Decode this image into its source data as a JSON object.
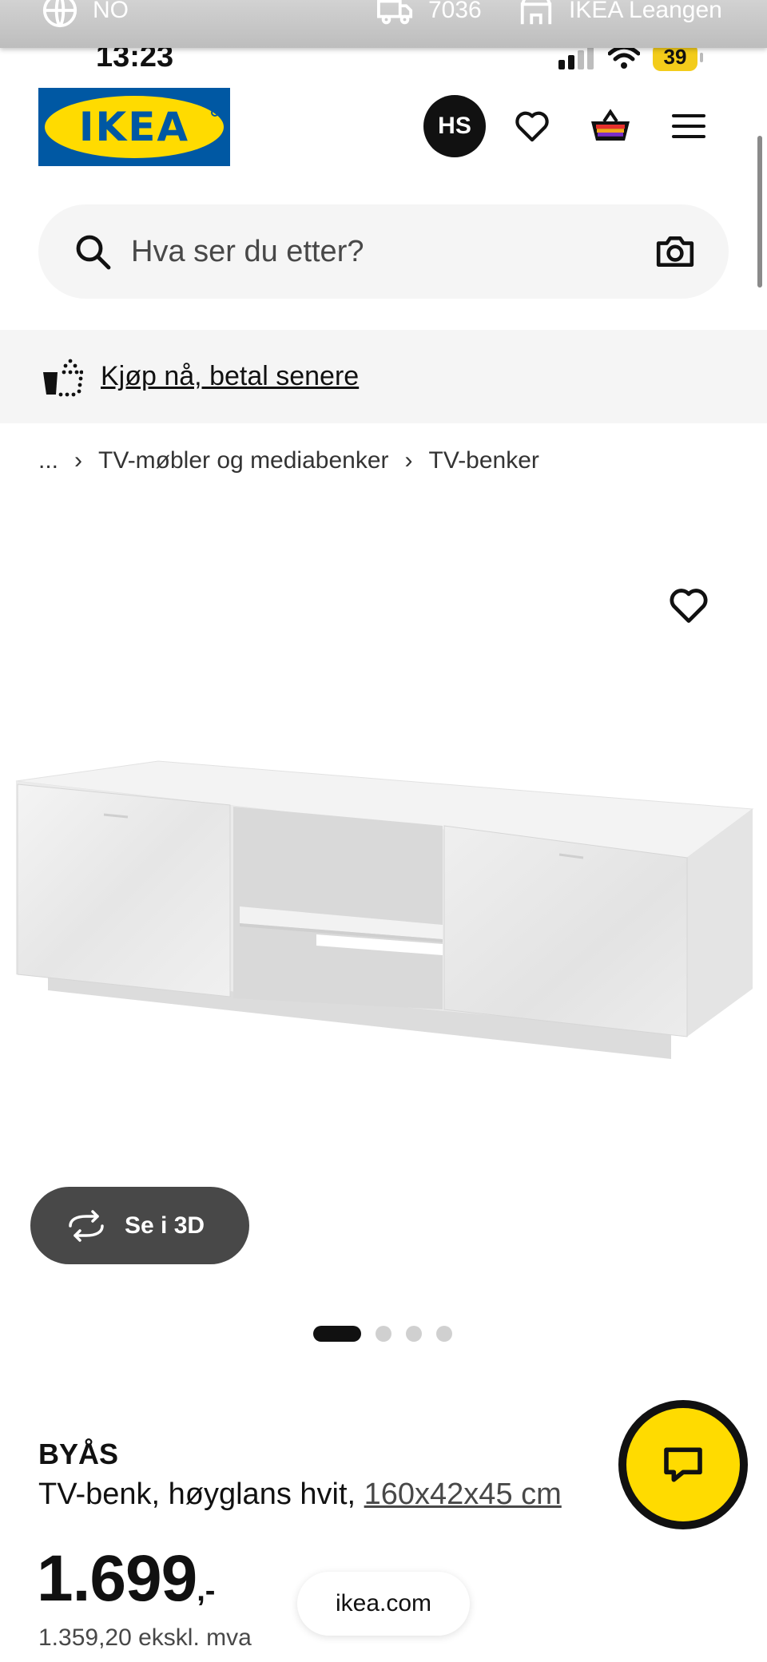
{
  "topbar": {
    "country": "NO",
    "postcode": "7036",
    "store": "IKEA Leangen"
  },
  "status": {
    "time": "13:23",
    "battery": "39"
  },
  "header": {
    "logo_text": "IKEA",
    "avatar_initials": "HS",
    "icons": [
      "heart-icon",
      "basket-icon",
      "menu-icon"
    ]
  },
  "search": {
    "placeholder": "Hva ser du etter?"
  },
  "promo": {
    "label": "Kjøp nå, betal senere"
  },
  "breadcrumb": {
    "ellipsis": "...",
    "items": [
      "TV-møbler og mediabenker",
      "TV-benker"
    ]
  },
  "gallery": {
    "view_3d_label": "Se i 3D",
    "image_count": 4,
    "active_index": 0
  },
  "product": {
    "name": "BYÅS",
    "description": "TV-benk, høyglans hvit,",
    "dimensions": "160x42x45 cm",
    "price": "1.699",
    "price_suffix": ",-",
    "price_ex_vat": "1.359,20 ekskl. mva"
  },
  "browser": {
    "url": "ikea.com"
  },
  "colors": {
    "ikea_blue": "#0058a3",
    "ikea_yellow": "#ffdb00",
    "dark": "#111111"
  }
}
